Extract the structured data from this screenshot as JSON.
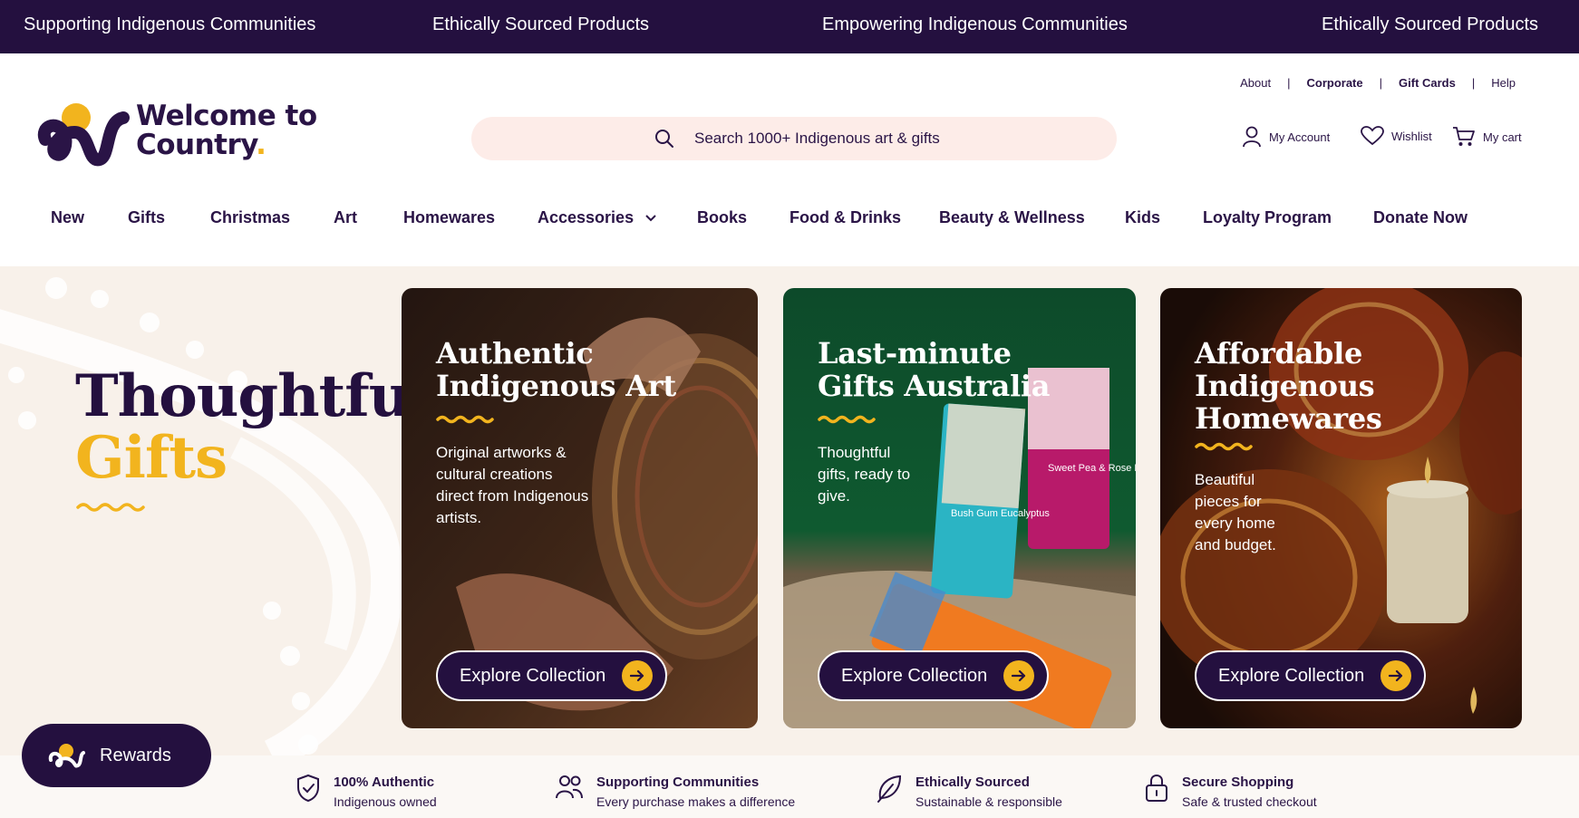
{
  "announcement": [
    "Supporting Indigenous Communities",
    "Ethically Sourced Products",
    "Empowering Indigenous Communities",
    "Ethically Sourced Products"
  ],
  "brand": {
    "line1": "Welcome to",
    "line2": "Country",
    "dot": ".",
    "accent": "#f2b41e",
    "primary": "#24103f"
  },
  "utility_links": [
    "About",
    "Corporate",
    "Gift Cards",
    "Help"
  ],
  "search": {
    "placeholder": "Search 1000+ Indigenous art & gifts",
    "icon": "search-icon"
  },
  "account": {
    "my_account": "My Account",
    "wishlist": "Wishlist",
    "cart": "My cart"
  },
  "nav": [
    "New",
    "Gifts",
    "Christmas",
    "Art",
    "Homewares",
    "Accessories",
    "Books",
    "Food & Drinks",
    "Beauty & Wellness",
    "Kids",
    "Loyalty Program",
    "Donate Now"
  ],
  "hero": {
    "title_line1": "Thoughtful",
    "title_line2": "Gifts",
    "cards": [
      {
        "title": "Authentic Indigenous Art",
        "body": "Original artworks & cultural creations direct from Indigenous artists.",
        "cta": "Explore Collection"
      },
      {
        "title": "Last-minute Gifts Australia",
        "body": "Thoughtful gifts, ready to give.",
        "cta": "Explore Collection",
        "product_labels": [
          "Bush Gum Eucalyptus",
          "Sweet Pea & Rose Myrtle"
        ]
      },
      {
        "title": "Affordable Indigenous Homewares",
        "body": "Beautiful pieces for every home and budget.",
        "cta": "Explore Collection"
      }
    ]
  },
  "trust": [
    {
      "title": "100% Authentic",
      "sub": "Indigenous owned",
      "icon": "shield-check-icon"
    },
    {
      "title": "Supporting Communities",
      "sub": "Every purchase makes a difference",
      "icon": "people-icon"
    },
    {
      "title": "Ethically Sourced",
      "sub": "Sustainable & responsible",
      "icon": "leaf-icon"
    },
    {
      "title": "Secure Shopping",
      "sub": "Safe & trusted checkout",
      "icon": "lock-icon"
    }
  ],
  "rewards": {
    "label": "Rewards"
  }
}
